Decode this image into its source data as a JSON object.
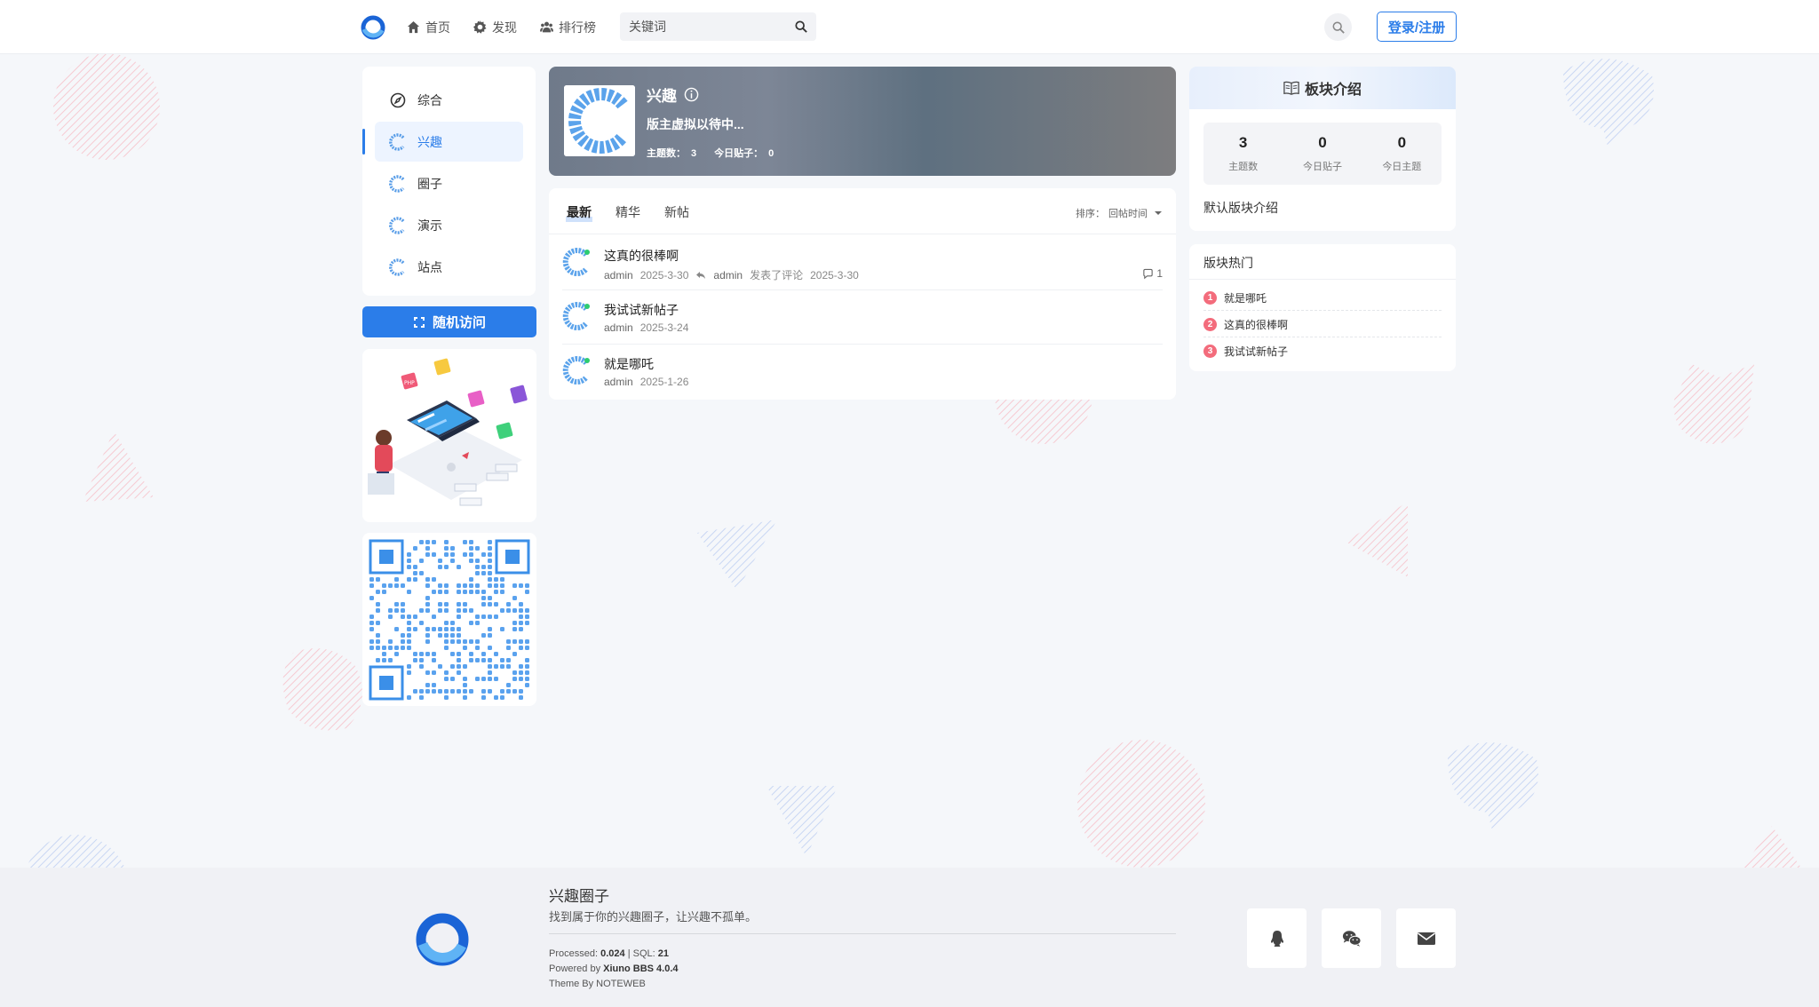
{
  "header": {
    "nav": [
      {
        "label": "首页",
        "icon": "home-icon"
      },
      {
        "label": "发现",
        "icon": "gear-icon"
      },
      {
        "label": "排行榜",
        "icon": "users-icon"
      }
    ],
    "search_placeholder": "关键词",
    "login_label": "登录/注册"
  },
  "sidebar": {
    "items": [
      {
        "label": "综合",
        "icon": "compass-icon"
      },
      {
        "label": "兴趣",
        "icon": "forum-icon"
      },
      {
        "label": "圈子",
        "icon": "forum-icon"
      },
      {
        "label": "演示",
        "icon": "forum-icon"
      },
      {
        "label": "站点",
        "icon": "forum-icon"
      }
    ],
    "active_index": 1,
    "random_label": "随机访问"
  },
  "forum": {
    "name": "兴趣",
    "moderator_text": "版主虚拟以待中...",
    "topics_label": "主题数：",
    "topics_value": "3",
    "today_posts_label": "今日贴子：",
    "today_posts_value": "0"
  },
  "threads": {
    "tabs": [
      "最新",
      "精华",
      "新帖"
    ],
    "active_tab": 0,
    "sort_label": "排序：",
    "sort_value": "回帖时间",
    "items": [
      {
        "title": "这真的很棒啊",
        "author": "admin",
        "date": "2025-3-30",
        "reply_user": "admin",
        "reply_text": "发表了评论",
        "reply_date": "2025-3-30",
        "replies": "1"
      },
      {
        "title": "我试试新帖子",
        "author": "admin",
        "date": "2025-3-24"
      },
      {
        "title": "就是哪吒",
        "author": "admin",
        "date": "2025-1-26"
      }
    ]
  },
  "intro": {
    "title": "板块介绍",
    "stats": [
      {
        "value": "3",
        "label": "主题数"
      },
      {
        "value": "0",
        "label": "今日贴子"
      },
      {
        "value": "0",
        "label": "今日主题"
      }
    ],
    "text": "默认版块介绍"
  },
  "hot": {
    "title": "版块热门",
    "items": [
      {
        "rank": "1",
        "title": "就是哪吒"
      },
      {
        "rank": "2",
        "title": "这真的很棒啊"
      },
      {
        "rank": "3",
        "title": "我试试新帖子"
      }
    ]
  },
  "footer": {
    "site_name": "兴趣圈子",
    "slogan": "找到属于你的兴趣圈子，让兴趣不孤单。",
    "processed_label": "Processed:",
    "processed_value": "0.024",
    "sql_label": "SQL:",
    "sql_value": "21",
    "powered_label": "Powered by",
    "powered_value": "Xiuno BBS 4.0.4",
    "theme_text": "Theme By NOTEWEB"
  },
  "colors": {
    "accent": "#2b7de9",
    "hot_badge": "#f36c7c",
    "background": "#f5f7fa"
  }
}
